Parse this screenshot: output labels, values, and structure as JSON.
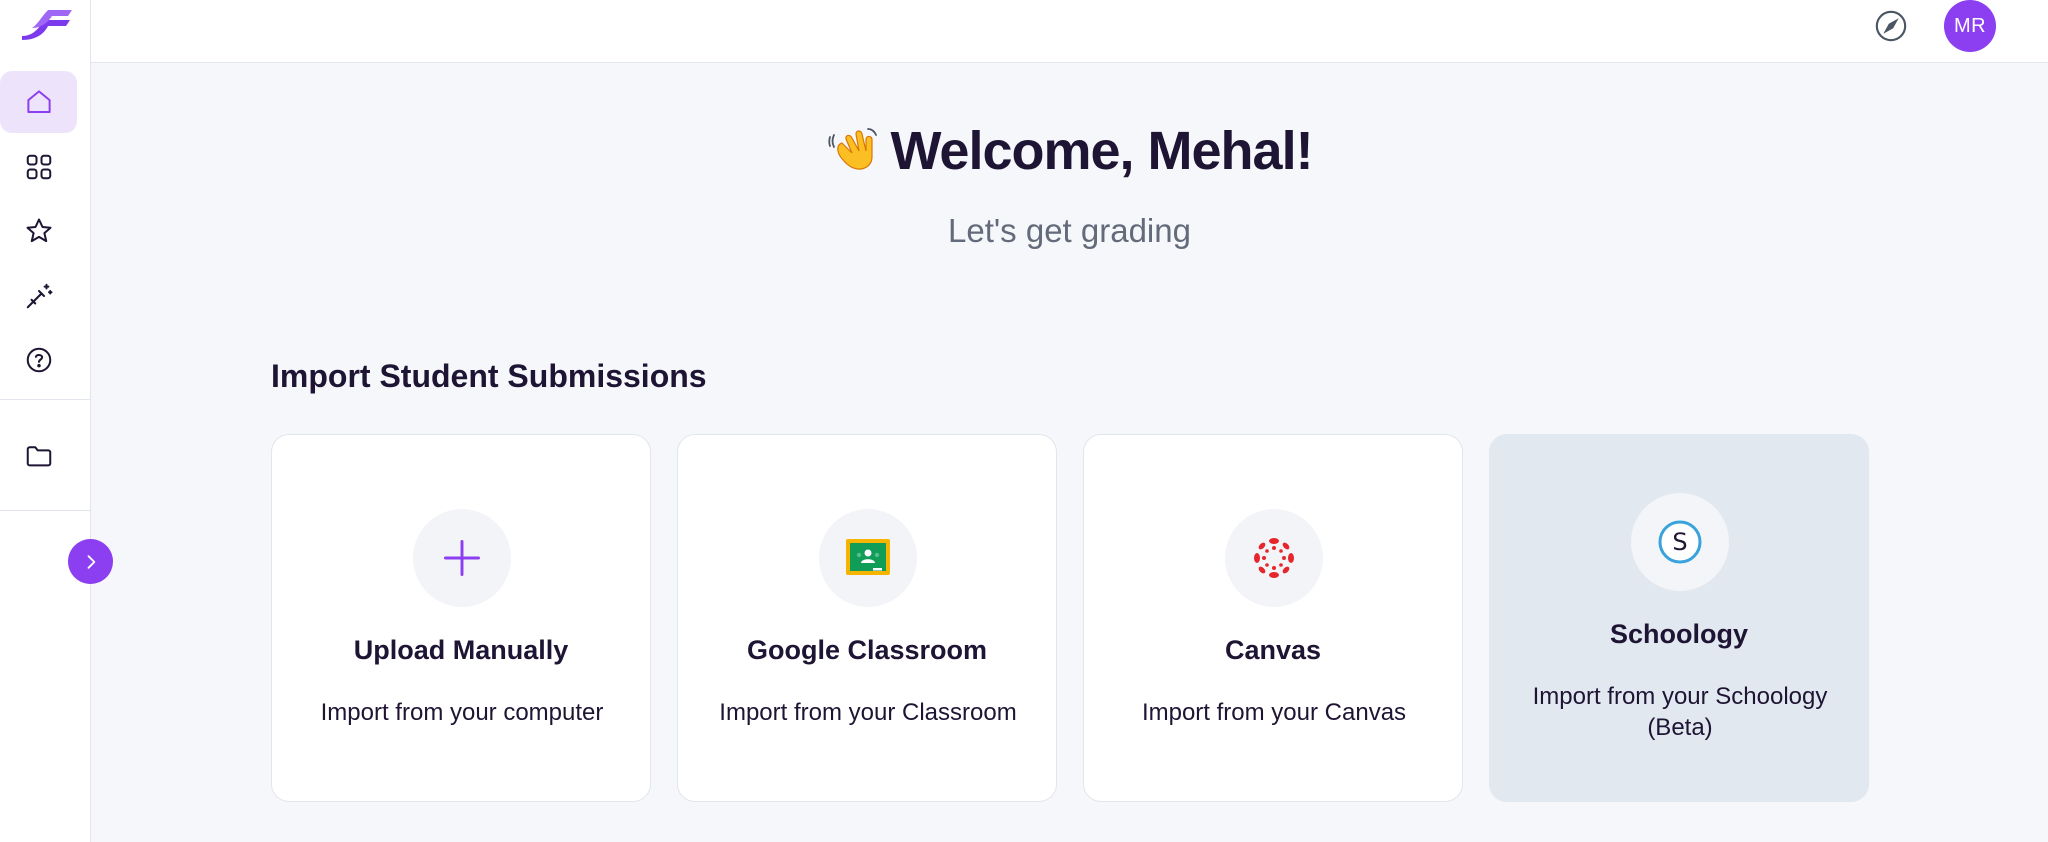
{
  "sidebar": {
    "items": [
      {
        "name": "home",
        "icon": "home-icon",
        "active": true
      },
      {
        "name": "apps",
        "icon": "grid-icon",
        "active": false
      },
      {
        "name": "favorites",
        "icon": "star-icon",
        "active": false
      },
      {
        "name": "magic",
        "icon": "magic-wand-icon",
        "active": false
      },
      {
        "name": "help",
        "icon": "help-circle-icon",
        "active": false
      },
      {
        "name": "folders",
        "icon": "folder-icon",
        "active": false
      }
    ],
    "accent": "#8b3ff0"
  },
  "topbar": {
    "avatar_initials": "MR"
  },
  "main": {
    "welcome": "Welcome, Mehal!",
    "subtitle": "Let's get grading",
    "section_title": "Import Student Submissions",
    "cards": [
      {
        "title": "Upload Manually",
        "desc": "Import from your computer",
        "icon": "plus-icon"
      },
      {
        "title": "Google Classroom",
        "desc": "Import from your Classroom",
        "icon": "google-classroom-icon"
      },
      {
        "title": "Canvas",
        "desc": "Import from your Canvas",
        "icon": "canvas-icon"
      },
      {
        "title": "Schoology",
        "desc": "Import from your Schoology (Beta)",
        "icon": "schoology-icon"
      }
    ]
  }
}
